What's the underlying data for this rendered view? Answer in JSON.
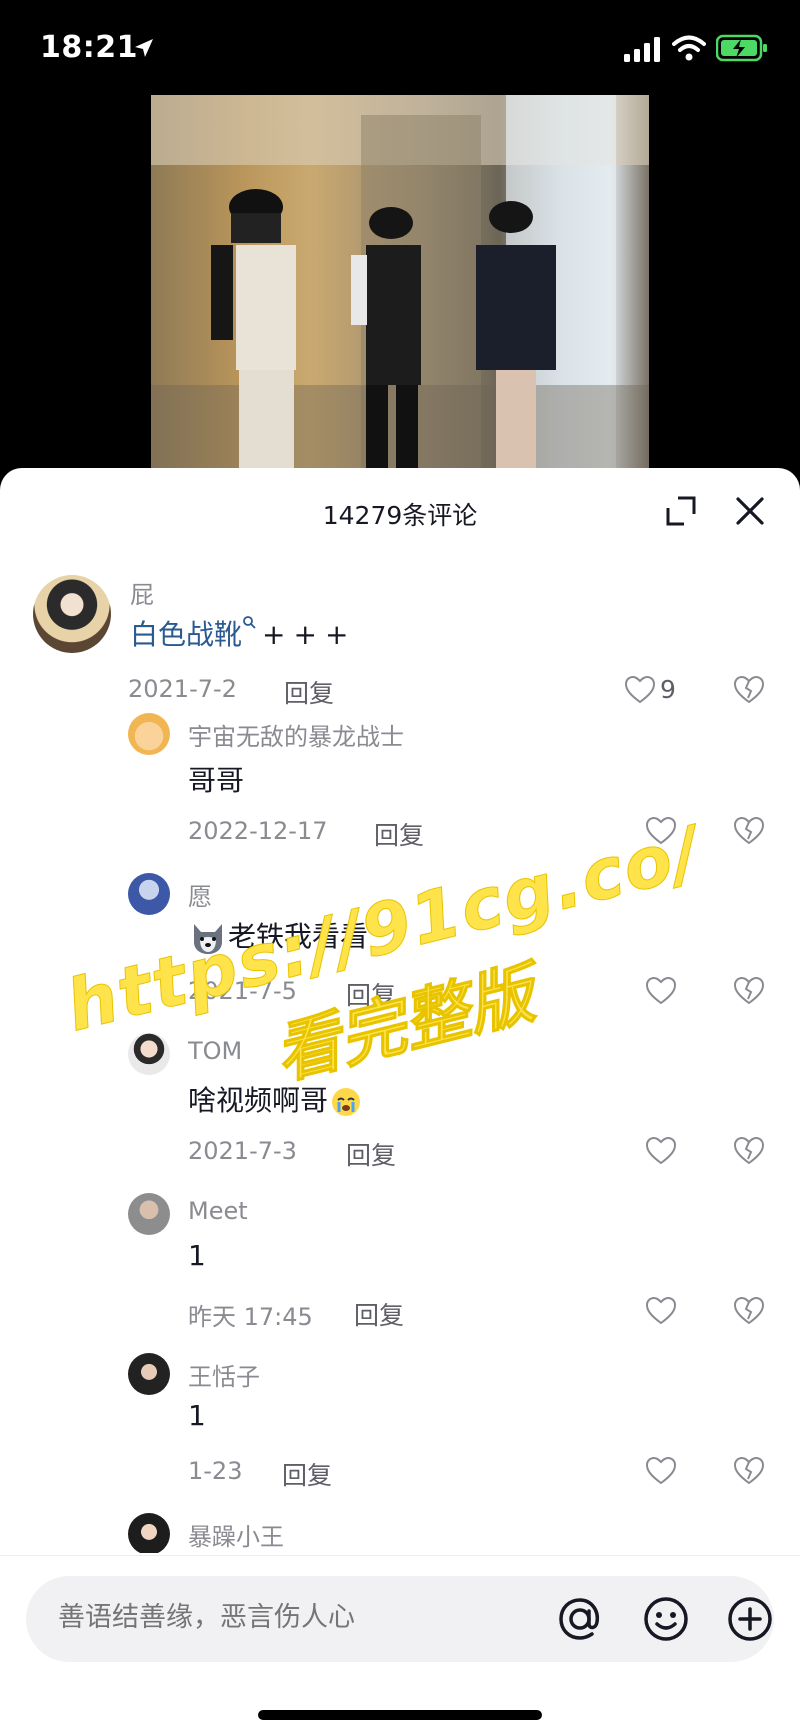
{
  "status_bar": {
    "time": "18:21"
  },
  "panel": {
    "title": "14279条评论"
  },
  "comments": [
    {
      "name": "屁",
      "link_text": "白色战靴",
      "text": "+++",
      "date": "2021-7-2",
      "reply": "回复",
      "likes": "9"
    },
    {
      "name": "宇宙无敌的暴龙战士",
      "text": "哥哥",
      "date": "2022-12-17",
      "reply": "回复"
    },
    {
      "name": "愿",
      "text": "老铁我看看",
      "date": "2021-7-5",
      "reply": "回复"
    },
    {
      "name": "TOM",
      "text": "啥视频啊哥",
      "date": "2021-7-3",
      "reply": "回复"
    },
    {
      "name": "Meet",
      "text": "1",
      "date": "昨天 17:45",
      "reply": "回复"
    },
    {
      "name": "王恬子",
      "text": "1",
      "date": "1-23",
      "reply": "回复"
    },
    {
      "name": "暴躁小王"
    }
  ],
  "watermark": {
    "url": "https://91cg.co/",
    "sub": "看完整版"
  },
  "input": {
    "placeholder": "善语结善缘，恶言伤人心"
  },
  "colors": {
    "link": "#2a5a8f",
    "watermark": "#ffe34a",
    "battery": "#4cd964"
  }
}
